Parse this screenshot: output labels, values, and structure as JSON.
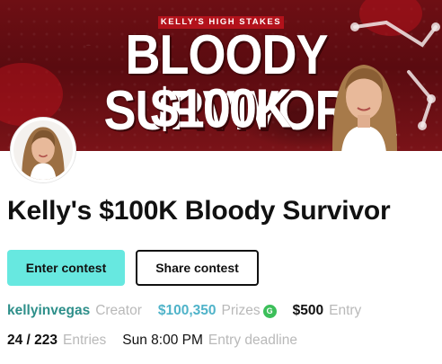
{
  "banner": {
    "kicker": "KELLY'S HIGH STAKES",
    "headline": "BLOODY SURVIVOR",
    "amount": "$100K"
  },
  "contest": {
    "title": "Kelly's $100K Bloody Survivor"
  },
  "actions": {
    "enter_label": "Enter contest",
    "share_label": "Share contest"
  },
  "details": {
    "creator_name": "kellyinvegas",
    "creator_label": "Creator",
    "prize_amount": "$100,350",
    "prize_label": "Prizes",
    "prize_badge": "G",
    "entry_fee": "$500",
    "entry_label": "Entry",
    "entries_count": "24 / 223",
    "entries_label": "Entries",
    "deadline_time": "Sun 8:00 PM",
    "deadline_label": "Entry deadline"
  },
  "colors": {
    "accent_button": "#67e8e0",
    "creator_link": "#2e8f8a",
    "prize_text": "#4fb3c9",
    "badge_green": "#3cbf5a",
    "banner_red": "#6e0f14"
  }
}
